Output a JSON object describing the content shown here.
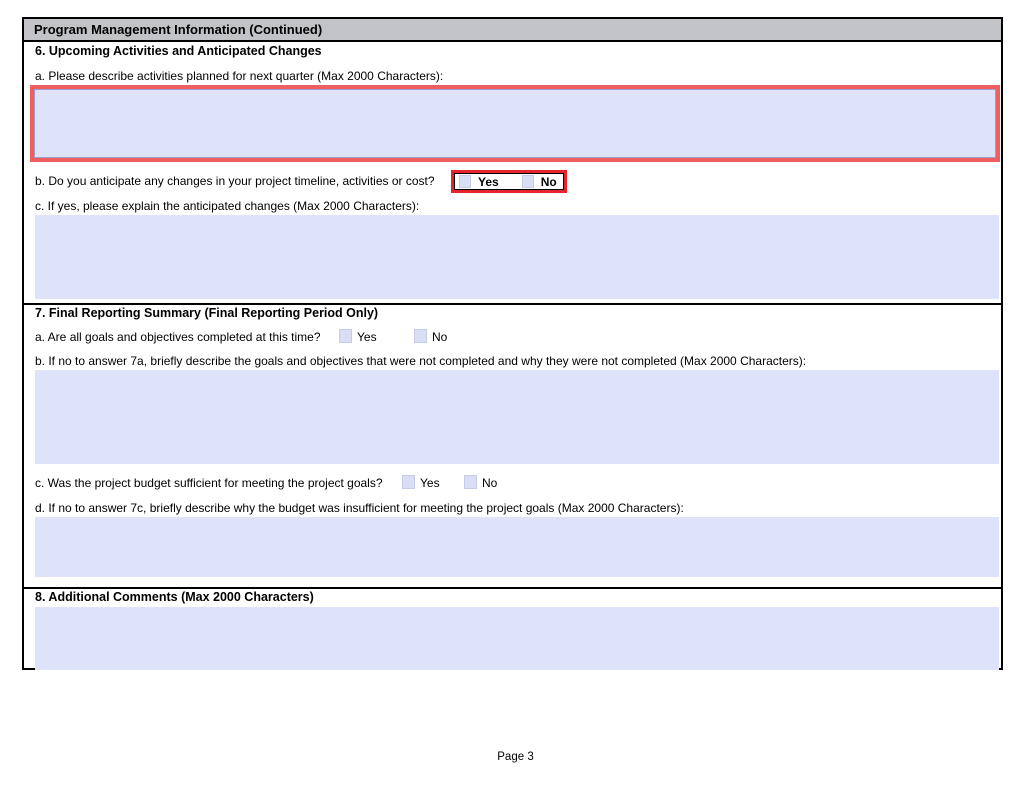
{
  "header": {
    "title": "Program Management Information (Continued)"
  },
  "section6": {
    "heading": "6. Upcoming Activities and Anticipated Changes",
    "qa_label": "a. Please describe activities planned for next quarter (Max 2000 Characters):",
    "qa_value": "",
    "qb_label": "b. Do you anticipate any changes in your project timeline, activities or cost?",
    "qb_yes_label": "Yes",
    "qb_no_label": "No",
    "qc_label": "c. If yes, please explain the anticipated changes (Max 2000 Characters):",
    "qc_value": ""
  },
  "section7": {
    "heading": "7. Final Reporting Summary (Final Reporting Period Only)",
    "qa_label": "a. Are all goals and objectives completed at this time?",
    "qa_yes_label": "Yes",
    "qa_no_label": "No",
    "qb_label": "b. If no to answer 7a, briefly describe the goals and objectives that were not completed and why they were not completed (Max 2000 Characters):",
    "qb_value": "",
    "qc_label": "c. Was the project budget sufficient for meeting the project goals?",
    "qc_yes_label": "Yes",
    "qc_no_label": "No",
    "qd_label": "d. If no to answer 7c, briefly describe why the budget was insufficient for meeting the project goals (Max 2000 Characters):",
    "qd_value": ""
  },
  "section8": {
    "heading": "8. Additional Comments (Max 2000 Characters)",
    "value": ""
  },
  "footer": {
    "text": "Page 3"
  },
  "colors": {
    "field_fill": "#dee3fa",
    "checkbox_fill": "#d9def4",
    "title_bar_gray": "#c2c3c6",
    "highlight_area_red": "#f15e60",
    "highlight_box_red": "#e6242b"
  }
}
